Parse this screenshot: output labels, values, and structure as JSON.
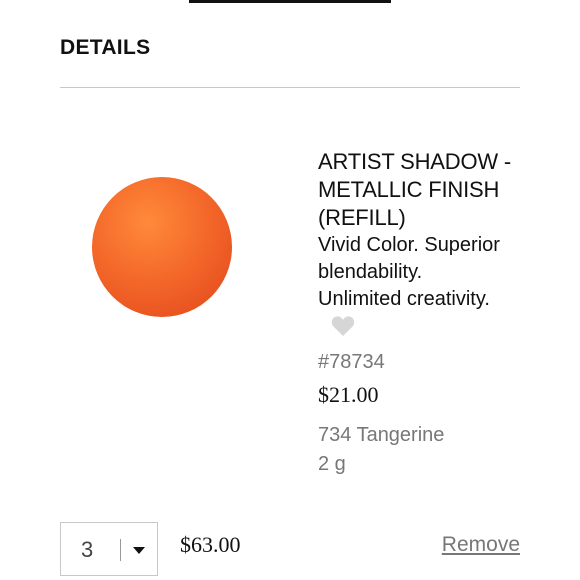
{
  "section": {
    "title": "DETAILS"
  },
  "product": {
    "name": "ARTIST SHADOW -\nMETALLIC FINISH\n(REFILL)",
    "description": "Vivid Color. Superior\nblendability.\nUnlimited creativity.",
    "sku": "#78734",
    "unit_price": "$21.00",
    "shade": "734 Tangerine",
    "size": "2 g",
    "swatch_color": "#f4692a",
    "wishlist_icon": "heart-icon"
  },
  "cart_line": {
    "quantity": "3",
    "line_total": "$63.00",
    "remove_label": "Remove"
  },
  "colors": {
    "text": "#111111",
    "muted": "#777777",
    "divider": "#c8c8c8",
    "heart": "#d6d6d6"
  }
}
